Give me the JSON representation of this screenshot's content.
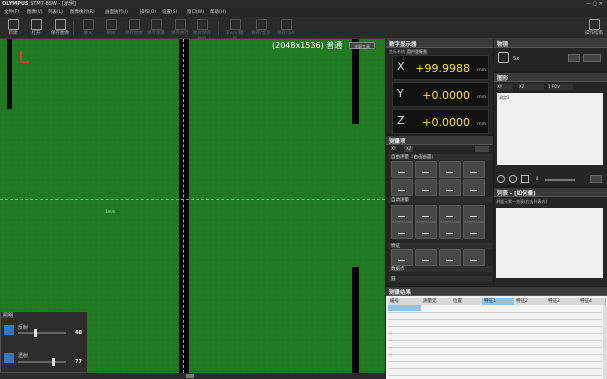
{
  "window": {
    "brand": "OLYMPUS",
    "model": "STM7-BSW",
    "doc": "- [示例]"
  },
  "menu": [
    "文件(F)",
    "图像(V)",
    "列表(L)",
    "图像执行(R)",
    "画面执行(I)",
    "操作(O)",
    "设置(S)",
    "窗口(W)",
    "帮助(H)"
  ],
  "toolbar": {
    "items": [
      {
        "label": "新建"
      },
      {
        "label": "打开"
      },
      {
        "label": "保存图像"
      },
      {
        "label": "撤入"
      },
      {
        "label": "删除"
      },
      {
        "label": "保存图像"
      },
      {
        "label": "保存测量"
      },
      {
        "label": "保存执行"
      },
      {
        "label": "图片保存执行"
      },
      {
        "label": "Excel输出"
      },
      {
        "label": "保存/显示"
      },
      {
        "label": "保存CSV"
      }
    ],
    "right_label": "操作指南"
  },
  "image": {
    "resolution": "(2048x1536)",
    "mode": "普通",
    "button": "全屏工具",
    "marker": "1mm"
  },
  "bottom_panel": {
    "title": "照明",
    "rows": [
      {
        "label": "反射",
        "value": "48"
      },
      {
        "label": "透射",
        "value": "77"
      }
    ]
  },
  "dro": {
    "title": "数字显示器",
    "tabs": [
      "坐标系统",
      "用户坐标系"
    ],
    "axes": [
      {
        "axis": "X",
        "value": "+99.9988",
        "unit": "mm"
      },
      {
        "axis": "Y",
        "value": "+0.0000",
        "unit": "mm"
      },
      {
        "axis": "Z",
        "value": "+0.0000",
        "unit": "mm"
      }
    ]
  },
  "camera": {
    "title": "物镜",
    "lens": "5x"
  },
  "graphics": {
    "title": "图形",
    "fields": [
      "XY",
      "XZ",
      "1 FOV"
    ],
    "note": "测定1",
    "zoom_value": "8"
  },
  "measure": {
    "title": "测量项",
    "tabs": [
      "XY",
      "XZ"
    ],
    "sections": [
      "自由测量（右击画面）",
      "自动测量",
      "特征",
      "数据点",
      "圆"
    ]
  },
  "list": {
    "title": "列表 - [如何量]",
    "subtitle": "测量元素一览表(右击列表内)"
  },
  "results": {
    "title": "测量结果",
    "columns": [
      "编号",
      "测量元",
      "位置",
      "特征1",
      "特征2",
      "特征3",
      "特征4"
    ],
    "selected_col": 3
  },
  "colors": {
    "bg": "#1f7a1f",
    "readout": "#f5e030"
  }
}
